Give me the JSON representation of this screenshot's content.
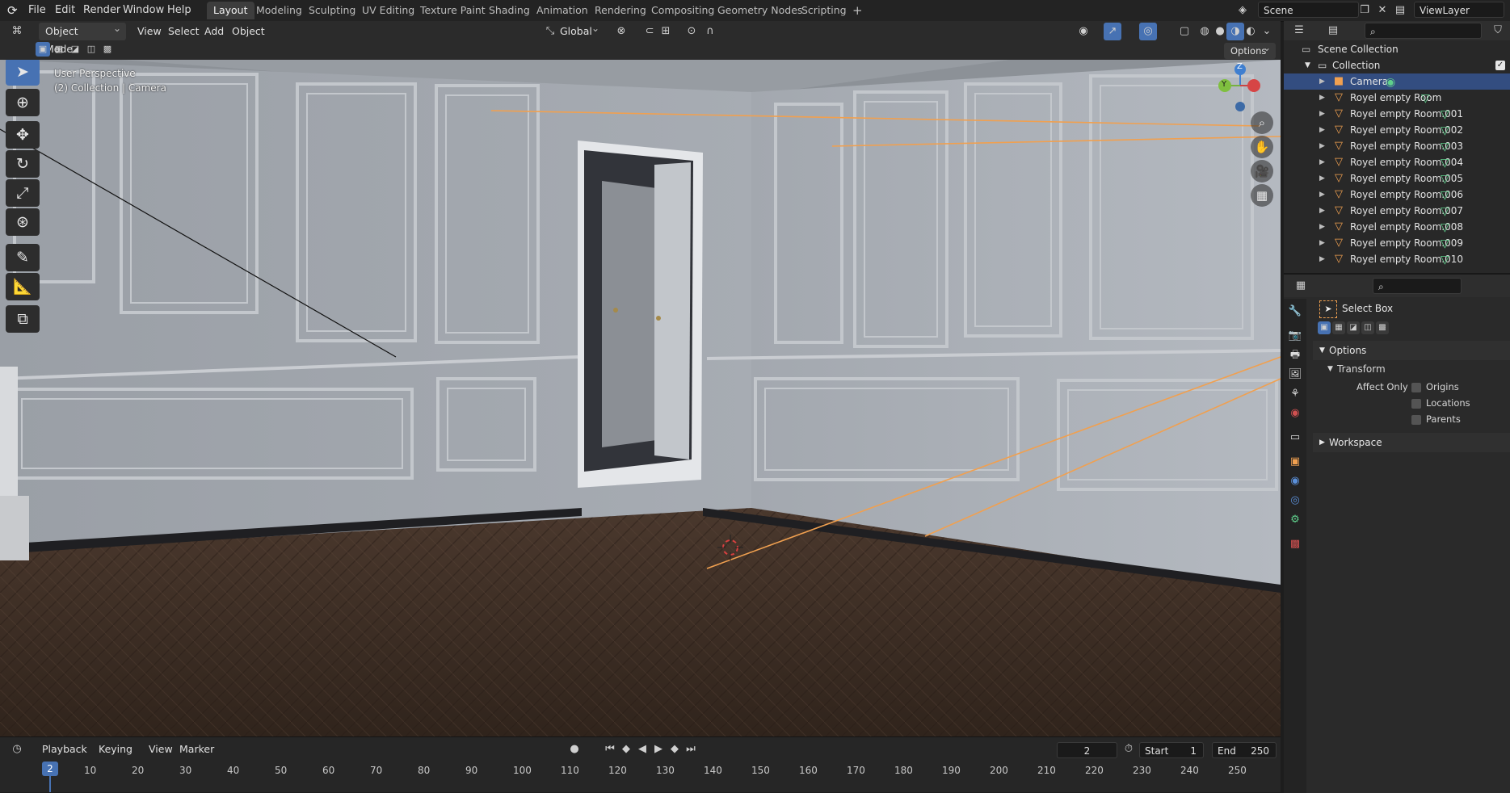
{
  "topbar": {
    "menus": [
      "File",
      "Edit",
      "Render",
      "Window",
      "Help"
    ],
    "workspace_tabs": [
      "Layout",
      "Modeling",
      "Sculpting",
      "UV Editing",
      "Texture Paint",
      "Shading",
      "Animation",
      "Rendering",
      "Compositing",
      "Geometry Nodes",
      "Scripting"
    ],
    "add_tab": "+",
    "scene_name": "Scene",
    "view_layer_name": "ViewLayer"
  },
  "viewport_header": {
    "mode": "Object Mode",
    "menus": [
      "View",
      "Select",
      "Add",
      "Object"
    ],
    "transform_orientation": "Global",
    "options_label": "Options"
  },
  "viewport": {
    "view_name": "User Perspective",
    "view_subtitle": "(2) Collection | Camera",
    "gizmo": {
      "x": "X",
      "y": "Y",
      "z": "Z"
    }
  },
  "timeline": {
    "menus": [
      "Playback",
      "Keying",
      "View",
      "Marker"
    ],
    "current_frame": "2",
    "start_label": "Start",
    "start_value": "1",
    "end_label": "End",
    "end_value": "250",
    "ruler_current": "2",
    "ruler_ticks": [
      "10",
      "20",
      "30",
      "40",
      "50",
      "60",
      "70",
      "80",
      "90",
      "100",
      "110",
      "120",
      "130",
      "140",
      "150",
      "160",
      "170",
      "180",
      "190",
      "200",
      "210",
      "220",
      "230",
      "240",
      "250"
    ]
  },
  "outliner": {
    "scene_collection": "Scene Collection",
    "collection": "Collection",
    "items": [
      {
        "name": "Camera",
        "type": "camera",
        "selected": true
      },
      {
        "name": "Royel empty Room",
        "type": "mesh"
      },
      {
        "name": "Royel empty Room.001",
        "type": "mesh"
      },
      {
        "name": "Royel empty Room.002",
        "type": "mesh"
      },
      {
        "name": "Royel empty Room.003",
        "type": "mesh"
      },
      {
        "name": "Royel empty Room.004",
        "type": "mesh"
      },
      {
        "name": "Royel empty Room.005",
        "type": "mesh"
      },
      {
        "name": "Royel empty Room.006",
        "type": "mesh"
      },
      {
        "name": "Royel empty Room.007",
        "type": "mesh"
      },
      {
        "name": "Royel empty Room.008",
        "type": "mesh"
      },
      {
        "name": "Royel empty Room.009",
        "type": "mesh"
      },
      {
        "name": "Royel empty Room.010",
        "type": "mesh"
      }
    ]
  },
  "properties": {
    "tool_name": "Select Box",
    "options_label": "Options",
    "transform_label": "Transform",
    "affect_only_label": "Affect Only",
    "checkboxes": [
      "Origins",
      "Locations",
      "Parents"
    ],
    "workspace_label": "Workspace"
  },
  "colors": {
    "accent": "#4772b3",
    "selection": "#334d80",
    "orange_line": "#f0a050",
    "mesh_data": "#5fcf8c"
  }
}
